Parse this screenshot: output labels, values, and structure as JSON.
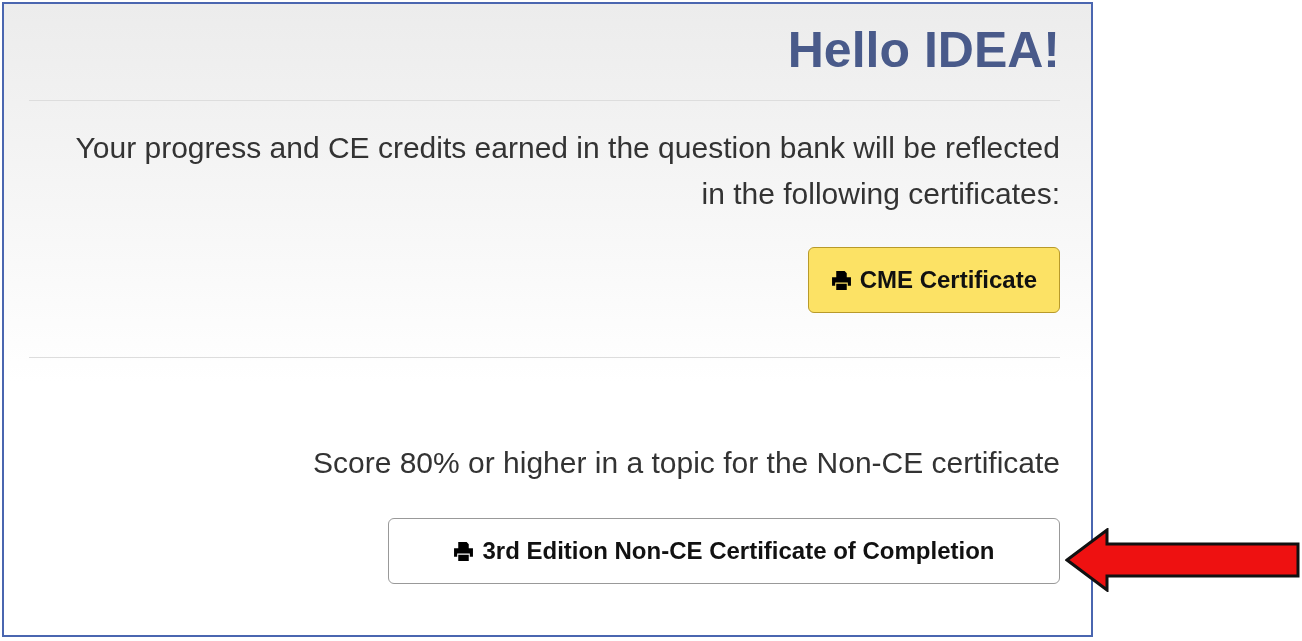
{
  "greeting": "Hello IDEA!",
  "ce_section": {
    "text": "Your progress and CE credits earned in the question bank will be reflected in the following certificates:",
    "button": "CME Certificate"
  },
  "non_ce_section": {
    "text": "Score 80% or higher in a topic for the Non-CE certificate",
    "button": "3rd Edition Non-CE Certificate of Completion"
  }
}
